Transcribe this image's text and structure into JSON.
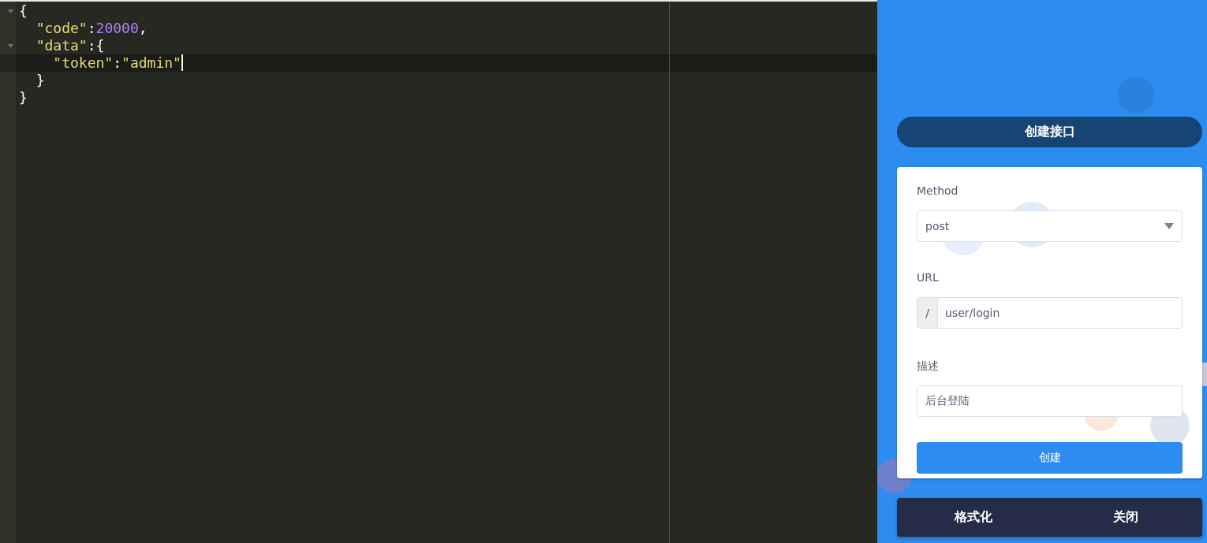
{
  "editor": {
    "lines": [
      {
        "foldable": true,
        "active": false,
        "cursor": false,
        "tokens": [
          {
            "kind": "punct",
            "text": "{"
          }
        ]
      },
      {
        "foldable": false,
        "active": false,
        "cursor": false,
        "tokens": [
          {
            "kind": "key",
            "text": "  \"code\""
          },
          {
            "kind": "punct",
            "text": ":"
          },
          {
            "kind": "number",
            "text": "20000"
          },
          {
            "kind": "punct",
            "text": ","
          }
        ]
      },
      {
        "foldable": true,
        "active": false,
        "cursor": false,
        "tokens": [
          {
            "kind": "key",
            "text": "  \"data\""
          },
          {
            "kind": "punct",
            "text": ":{"
          }
        ]
      },
      {
        "foldable": false,
        "active": true,
        "cursor": true,
        "tokens": [
          {
            "kind": "key",
            "text": "    \"token\""
          },
          {
            "kind": "punct",
            "text": ":"
          },
          {
            "kind": "string",
            "text": "\"admin\""
          }
        ]
      },
      {
        "foldable": false,
        "active": false,
        "cursor": false,
        "tokens": [
          {
            "kind": "punct",
            "text": "  }"
          }
        ]
      },
      {
        "foldable": false,
        "active": false,
        "cursor": false,
        "tokens": [
          {
            "kind": "punct",
            "text": "}"
          }
        ]
      }
    ]
  },
  "panel": {
    "title": "创建接口",
    "form": {
      "method_label": "Method",
      "method_value": "post",
      "url_label": "URL",
      "url_prefix": "/",
      "url_value": "user/login",
      "description_label": "描述",
      "description_value": "后台登陆",
      "submit": "创建"
    },
    "actions": [
      "格式化",
      "关闭"
    ]
  }
}
